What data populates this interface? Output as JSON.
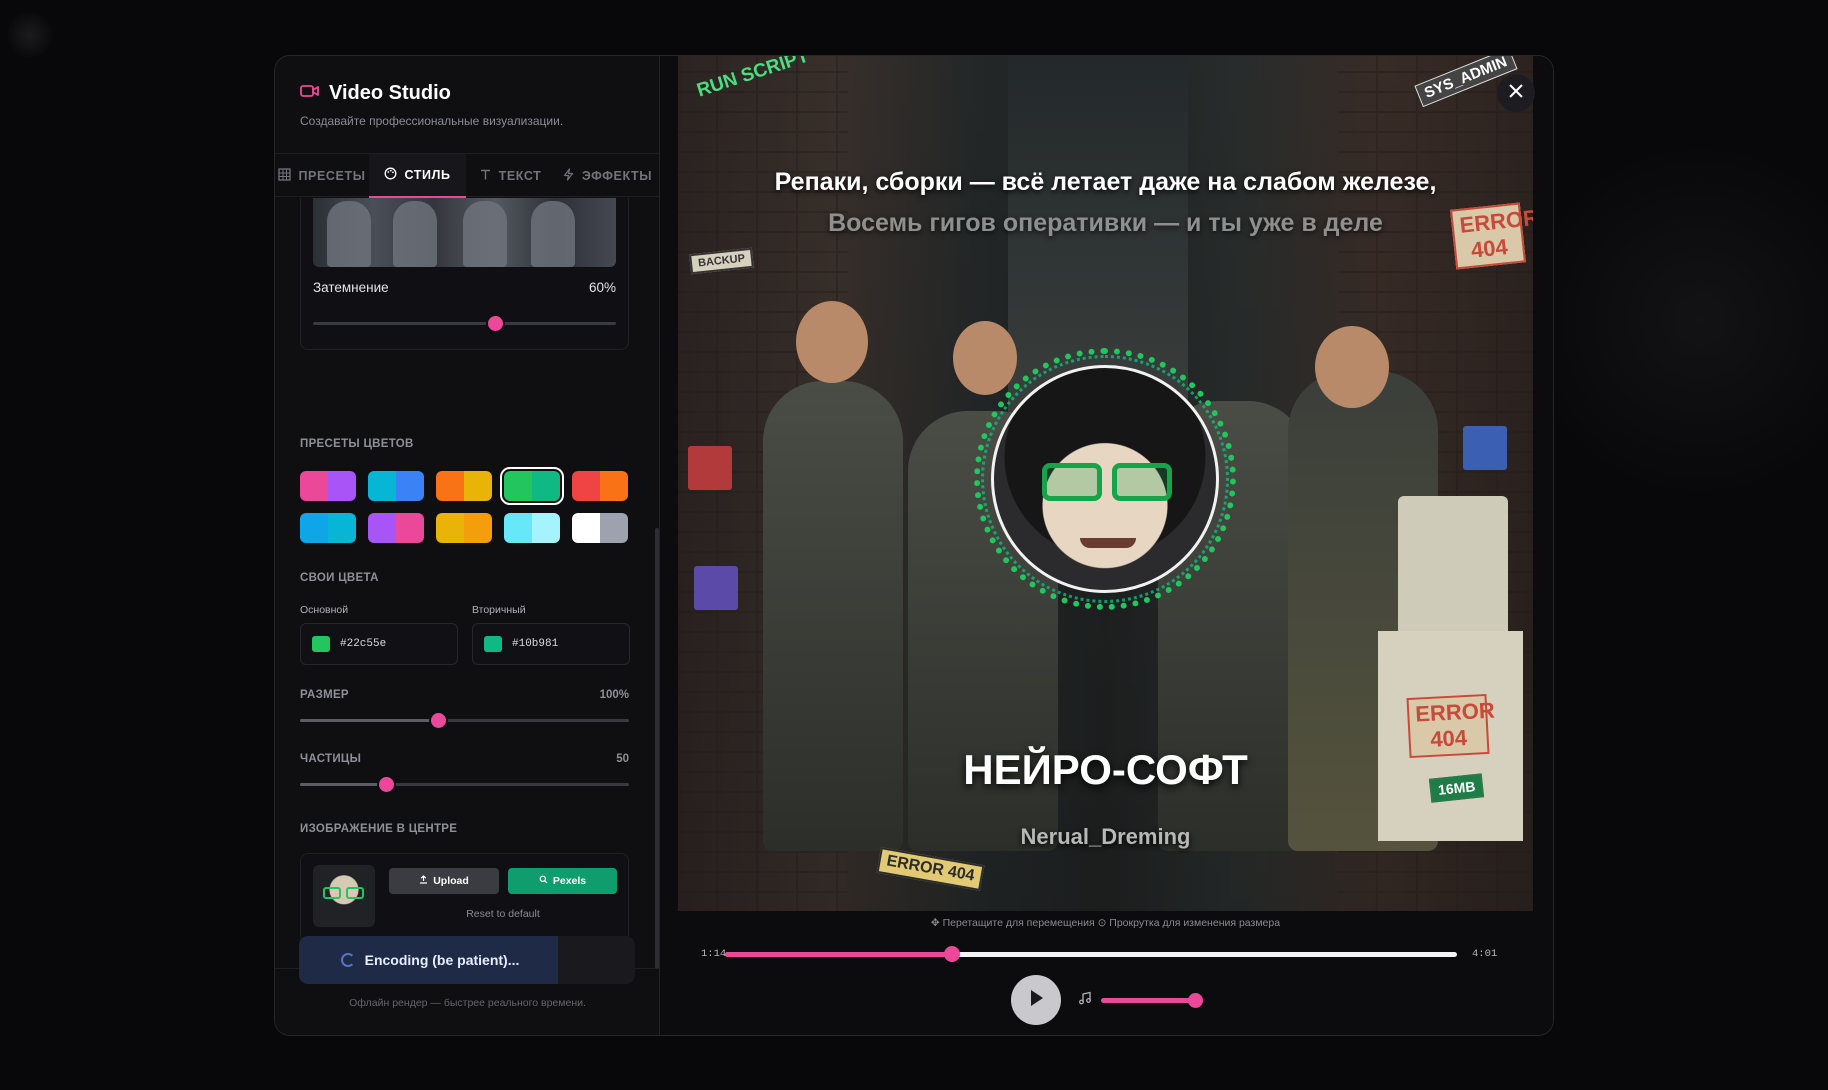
{
  "header": {
    "title": "Video Studio",
    "subtitle": "Создавайте профессиональные визуализации."
  },
  "tabs": [
    {
      "label": "ПРЕСЕТЫ",
      "icon": "grid-icon",
      "active": false
    },
    {
      "label": "СТИЛЬ",
      "icon": "palette-icon",
      "active": true
    },
    {
      "label": "ТЕКСТ",
      "icon": "text-icon",
      "active": false
    },
    {
      "label": "ЭФФЕКТЫ",
      "icon": "bolt-icon",
      "active": false
    }
  ],
  "background": {
    "dim_label": "Затемнение",
    "dim_value": "60%",
    "dim_level": 0.6
  },
  "presets": {
    "title": "ПРЕСЕТЫ ЦВЕТОВ",
    "items": [
      [
        "#ec4899",
        "#a855f7"
      ],
      [
        "#06b6d4",
        "#3b82f6"
      ],
      [
        "#f97316",
        "#eab308"
      ],
      [
        "#22c55e",
        "#10b981"
      ],
      [
        "#ef4444",
        "#f97316"
      ],
      [
        "#0ea5e9",
        "#06b6d4"
      ],
      [
        "#a855f7",
        "#ec4899"
      ],
      [
        "#eab308",
        "#f59e0b"
      ],
      [
        "#67e8f9",
        "#a5f3fc"
      ],
      [
        "#ffffff",
        "#9ca3af"
      ]
    ],
    "selected_index": 3
  },
  "custom_colors": {
    "title": "СВОИ ЦВЕТА",
    "primary_label": "Основной",
    "primary_value": "#22c55e",
    "secondary_label": "Вторичный",
    "secondary_value": "#10b981"
  },
  "size": {
    "label": "РАЗМЕР",
    "value": "100%",
    "level": 0.42
  },
  "particles": {
    "label": "ЧАСТИЦЫ",
    "value": "50",
    "level": 0.26
  },
  "center_image": {
    "title": "ИЗОБРАЖЕНИЕ В ЦЕНТРЕ",
    "upload_label": "Upload",
    "pexels_label": "Pexels",
    "reset_label": "Reset to default"
  },
  "encode": {
    "label": "Encoding (be patient)...",
    "progress": 0.77,
    "note": "Офлайн рендер — быстрее реального времени."
  },
  "preview": {
    "lyric_current": "Репаки, сборки — всё летает даже на слабом железе,",
    "lyric_next": "Восемь гигов оперативки — и ты уже в деле",
    "title": "НЕЙРО-СОФТ",
    "artist": "Nerual_Dreming",
    "scene_text": [
      "RUN SCRIPT",
      "SYS_ADMIN",
      "ERROR 404",
      "BACKUP",
      "16MB"
    ],
    "hint": "✥ Перетащите для перемещения ⊙ Прокрутка для изменения размера"
  },
  "player": {
    "current_time": "1:14",
    "total_time": "4:01",
    "progress": 0.31,
    "volume": 1.0
  },
  "colors": {
    "accent": "#ec4899",
    "primary": "#22c55e",
    "secondary": "#10b981"
  }
}
